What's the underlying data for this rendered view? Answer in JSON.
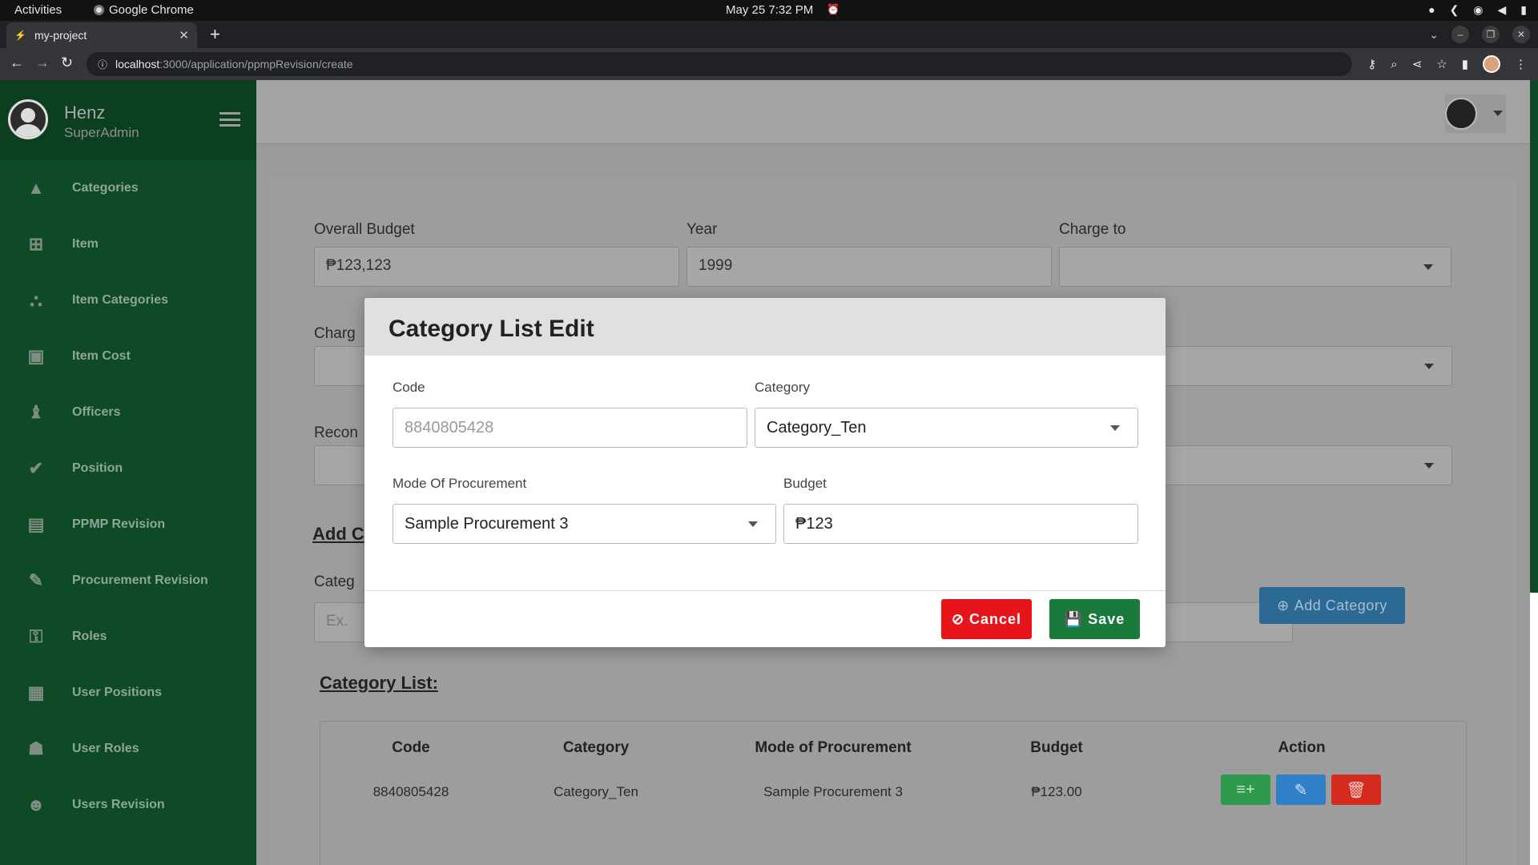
{
  "os": {
    "activities": "Activities",
    "app_name": "Google Chrome",
    "clock": "May 25  7:32 PM"
  },
  "browser": {
    "tab_title": "my-project",
    "url_host": "localhost",
    "url_path": ":3000/application/ppmpRevision/create"
  },
  "sidebar": {
    "user_name": "Henz",
    "user_role": "SuperAdmin",
    "items": [
      {
        "label": "Categories",
        "icon": "shapes-icon"
      },
      {
        "label": "Item",
        "icon": "plus-square-icon"
      },
      {
        "label": "Item Categories",
        "icon": "sitemap-icon"
      },
      {
        "label": "Item Cost",
        "icon": "money-icon"
      },
      {
        "label": "Officers",
        "icon": "chair-icon"
      },
      {
        "label": "Position",
        "icon": "user-check-icon"
      },
      {
        "label": "PPMP Revision",
        "icon": "book-icon"
      },
      {
        "label": "Procurement Revision",
        "icon": "edit-document-icon"
      },
      {
        "label": "Roles",
        "icon": "user-key-icon"
      },
      {
        "label": "User Positions",
        "icon": "building-icon"
      },
      {
        "label": "User Roles",
        "icon": "user-lock-icon"
      },
      {
        "label": "Users Revision",
        "icon": "users-icon"
      }
    ]
  },
  "form": {
    "overall_budget_label": "Overall Budget",
    "overall_budget_value": "₱123,123",
    "year_label": "Year",
    "year_value": "1999",
    "charge_to_label": "Charge to",
    "charge_label_partial": "Charg",
    "recom_label_partial": "Recon",
    "add_category_title_partial": "Add C",
    "category_label_partial": "Categ",
    "category_placeholder_partial": "Ex. ",
    "add_category_button": "Add Category"
  },
  "category_list": {
    "title": "Category List:",
    "columns": [
      "Code",
      "Category",
      "Mode of Procurement",
      "Budget",
      "Action"
    ],
    "rows": [
      {
        "code": "8840805428",
        "category": "Category_Ten",
        "mode": "Sample Procurement 3",
        "budget": "₱123.00"
      }
    ]
  },
  "modal": {
    "title": "Category List Edit",
    "code_label": "Code",
    "code_value": "8840805428",
    "category_label": "Category",
    "category_value": "Category_Ten",
    "mode_label": "Mode Of Procurement",
    "mode_value": "Sample Procurement 3",
    "budget_label": "Budget",
    "budget_value": "₱123",
    "cancel_label": "Cancel",
    "save_label": "Save"
  },
  "colors": {
    "sidebar": "#0d4a25",
    "cancel": "#e8141b",
    "save": "#197a3b",
    "add_row": "#2e9a4e",
    "edit": "#2f80c8",
    "delete": "#d42b1e"
  }
}
